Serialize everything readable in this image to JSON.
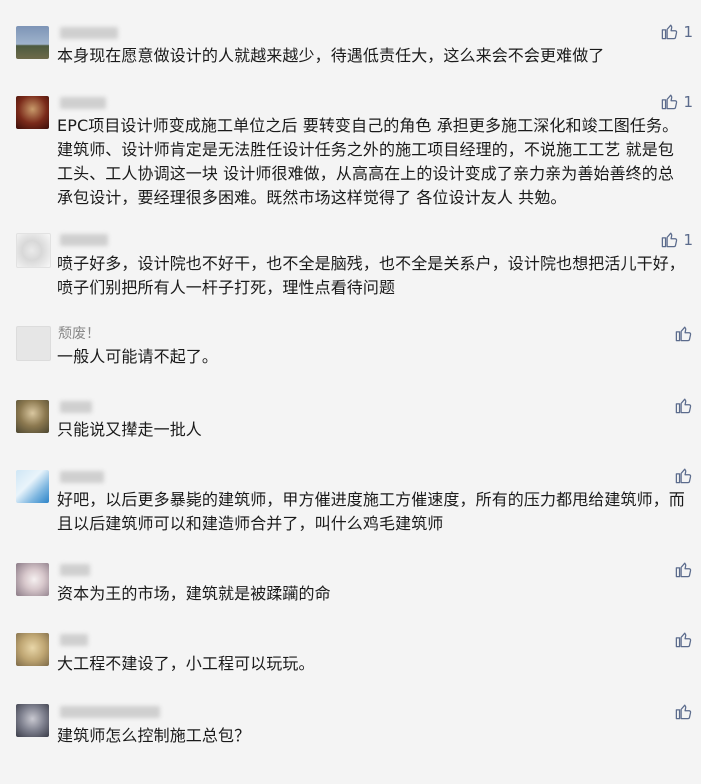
{
  "comments": [
    {
      "name": "",
      "text": "本身现在愿意做设计的人就越来越少，待遇低责任大，这么来会不会更难做了",
      "likes": "1"
    },
    {
      "name": "",
      "text": "EPC项目设计师变成施工单位之后 要转变自己的角色 承担更多施工深化和竣工图任务。建筑师、设计师肯定是无法胜任设计任务之外的施工项目经理的，不说施工工艺 就是包工头、工人协调这一块 设计师很难做，从高高在上的设计变成了亲力亲为善始善终的总承包设计，要经理很多困难。既然市场这样觉得了 各位设计友人 共勉。",
      "likes": "1"
    },
    {
      "name": "",
      "text": "喷子好多，设计院也不好干，也不全是脑残，也不全是关系户，设计院也想把活儿干好，喷子们别把所有人一杆子打死，理性点看待问题",
      "likes": "1"
    },
    {
      "name": "颓废！",
      "text": "一般人可能请不起了。",
      "likes": ""
    },
    {
      "name": "",
      "text": "只能说又撵走一批人",
      "likes": ""
    },
    {
      "name": "",
      "text": "好吧，以后更多暴毙的建筑师，甲方催进度施工方催速度，所有的压力都甩给建筑师，而且以后建筑师可以和建造师合并了，叫什么鸡毛建筑师",
      "likes": ""
    },
    {
      "name": "",
      "text": "资本为王的市场，建筑就是被蹂躏的命",
      "likes": ""
    },
    {
      "name": "",
      "text": "大工程不建设了，小工程可以玩玩。",
      "likes": ""
    },
    {
      "name": "",
      "text": "建筑师怎么控制施工总包？",
      "likes": ""
    }
  ],
  "icons": {
    "like": "thumbs-up-icon"
  },
  "colors": {
    "background": "#f4f4f4",
    "like": "#5b6b8c",
    "name": "#8a8a8a"
  }
}
